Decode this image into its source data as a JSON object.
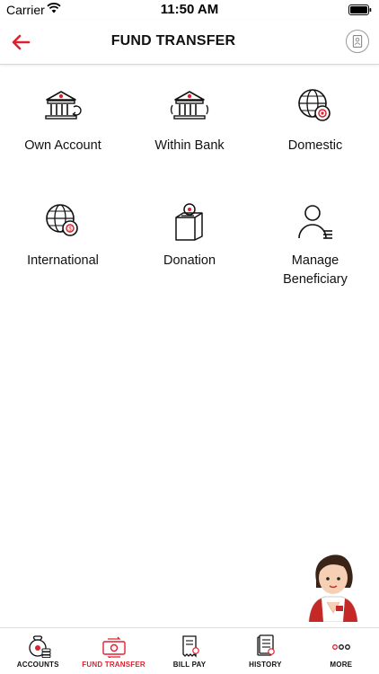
{
  "status": {
    "carrier": "Carrier",
    "time": "11:50 AM"
  },
  "header": {
    "title": "FUND TRANSFER",
    "back_icon": "arrow-left-icon",
    "profile_icon": "profile-icon"
  },
  "colors": {
    "accent": "#e0202e",
    "text": "#111111",
    "divider": "#dcdcdc"
  },
  "options": [
    {
      "label": "Own Account",
      "icon": "bank-own-account-icon"
    },
    {
      "label": "Within Bank",
      "icon": "bank-within-icon"
    },
    {
      "label": "Domestic",
      "icon": "globe-domestic-icon"
    },
    {
      "label": "International",
      "icon": "globe-international-icon"
    },
    {
      "label": "Donation",
      "icon": "donation-box-icon"
    },
    {
      "label": "Manage\nBeneficiary",
      "icon": "beneficiary-icon"
    }
  ],
  "tabs": [
    {
      "label": "ACCOUNTS",
      "icon": "accounts-icon",
      "active": false
    },
    {
      "label": "FUND TRANSFER",
      "icon": "fund-transfer-icon",
      "active": true
    },
    {
      "label": "BILL PAY",
      "icon": "bill-pay-icon",
      "active": false
    },
    {
      "label": "HISTORY",
      "icon": "history-icon",
      "active": false
    },
    {
      "label": "MORE",
      "icon": "more-icon",
      "active": false
    }
  ]
}
